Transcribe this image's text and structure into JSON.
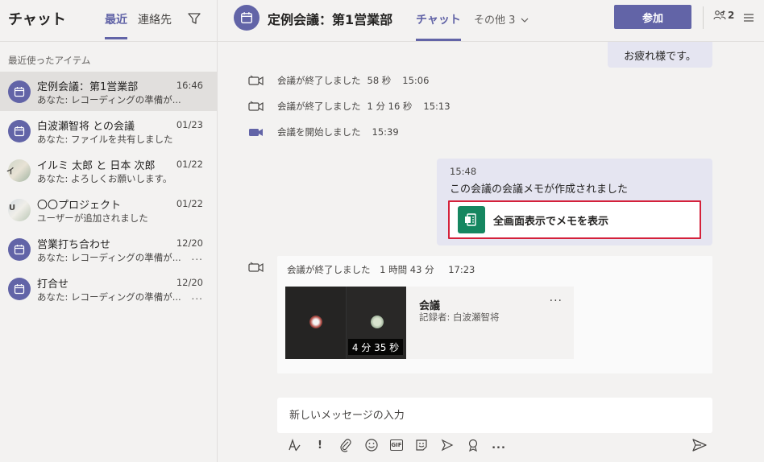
{
  "sidebar": {
    "title": "チャット",
    "tabs": [
      {
        "label": "最近",
        "active": true
      },
      {
        "label": "連絡先",
        "active": false
      }
    ],
    "section_label": "最近使ったアイテム",
    "items": [
      {
        "name": "定例会議：第1営業部",
        "time": "16:46",
        "preview": "あなた: レコーディングの準備が...",
        "avatar": "calendar-icon",
        "selected": true,
        "more": ""
      },
      {
        "name": "白波瀬智将 との会議",
        "time": "01/23",
        "preview": "あなた: ファイルを共有しました",
        "avatar": "calendar-icon",
        "selected": false,
        "more": ""
      },
      {
        "name": "イルミ 太郎 と 日本 次郎",
        "time": "01/22",
        "preview": "あなた: よろしくお願いします。",
        "avatar": "photo",
        "avatar_initial": "イ",
        "selected": false,
        "more": ""
      },
      {
        "name": "〇〇プロジェクト",
        "time": "01/22",
        "preview": "ユーザーが追加されました",
        "avatar": "photo",
        "avatar_initial": "U",
        "selected": false,
        "more": ""
      },
      {
        "name": "営業打ち合わせ",
        "time": "12/20",
        "preview": "あなた: レコーディングの準備が...",
        "avatar": "calendar-icon",
        "selected": false,
        "more": "..."
      },
      {
        "name": "打合せ",
        "time": "12/20",
        "preview": "あなた: レコーディングの準備が...",
        "avatar": "calendar-icon",
        "selected": false,
        "more": "..."
      }
    ]
  },
  "header": {
    "title": "定例会議：第1営業部",
    "chat_tab": "チャット",
    "other_tab": "その他 3",
    "join_label": "参加",
    "participant_count": "2"
  },
  "messages": {
    "top_bubble": "お疲れ様です。",
    "events": [
      {
        "text": "会議が終了しました",
        "duration": "58 秒",
        "time": "15:06",
        "icon": "video-camera-icon"
      },
      {
        "text": "会議が終了しました",
        "duration": "1 分 16 秒",
        "time": "15:13",
        "icon": "video-camera-icon"
      },
      {
        "text": "会議を開始しました",
        "duration": "",
        "time": "15:39",
        "icon": "video-camera-filled-icon"
      }
    ],
    "note": {
      "time": "15:48",
      "text": "この会議の会議メモが作成されました",
      "button_label": "全画面表示でメモを表示"
    },
    "recording": {
      "text": "会議が終了しました",
      "duration": "1 時間 43 分",
      "time": "17:23",
      "video_duration": "4 分 35 秒",
      "title": "会議",
      "recorder": "記録者: 白波瀬智将",
      "more": "..."
    }
  },
  "compose": {
    "placeholder": "新しいメッセージの入力"
  },
  "toolbar": {
    "icons": [
      "format-icon",
      "important-icon",
      "attach-icon",
      "emoji-icon",
      "gif-icon",
      "sticker-icon",
      "meet-now-icon",
      "praise-icon",
      "more-options-icon"
    ],
    "gif_label": "GIF",
    "important_label": "!",
    "more_label": "..."
  },
  "colors": {
    "accent": "#6264a7",
    "bubble": "#e5e5f1",
    "highlight": "#d4213b",
    "onenote_tile": "#158660"
  }
}
